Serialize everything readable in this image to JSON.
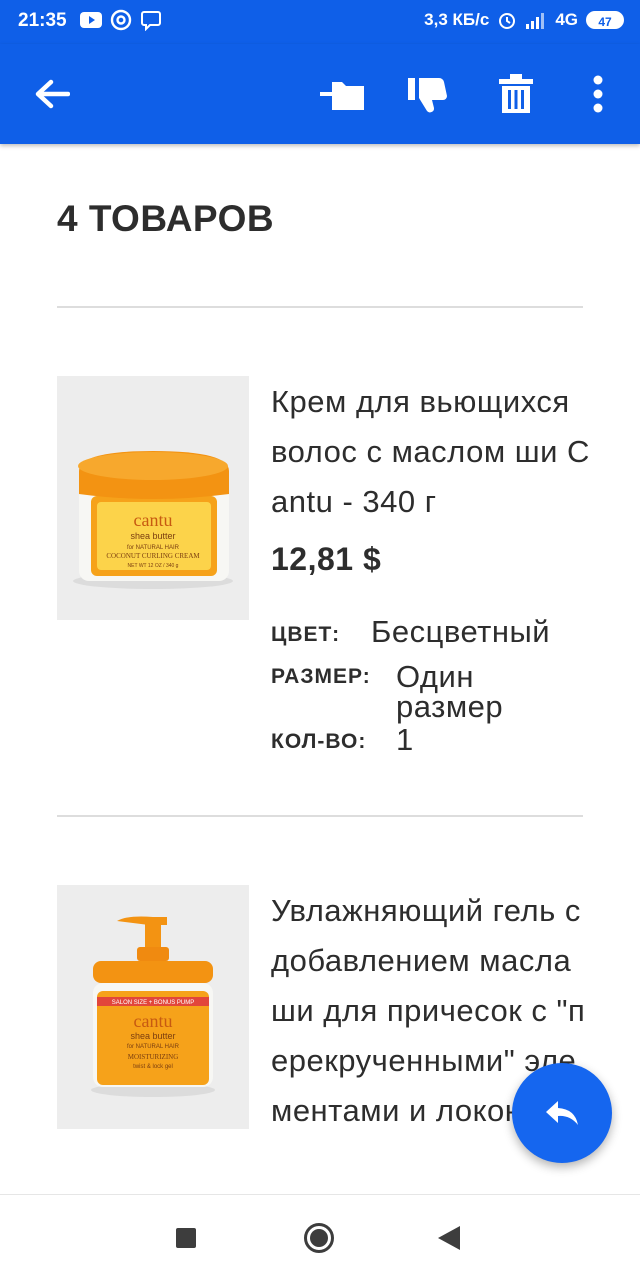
{
  "status_bar": {
    "time": "21:35",
    "speed": "3,3 КБ/с",
    "network": "4G",
    "battery": "47"
  },
  "toolbar": {
    "icons": [
      "back-arrow-icon",
      "move-to-folder-icon",
      "thumbs-down-icon",
      "trash-icon",
      "more-vert-icon"
    ]
  },
  "order": {
    "count_title": "4 ТОВАРОВ",
    "items": [
      {
        "name": "Крем для вьющихся волос с маслом ши Cantu - 340 г",
        "price": "12,81 $",
        "color_label": "ЦВЕТ:",
        "color_value": "Бесцветный",
        "size_label": "РАЗМЕР:",
        "size_value_line1": "Один",
        "size_value_line2": "размер",
        "qty_label": "КОЛ-ВО:",
        "qty_value": "1",
        "image": {
          "brand": "cantu",
          "line1": "shea butter",
          "line2": "for NATURAL HAIR",
          "product": "COCONUT CURLING CREAM",
          "weight": "NET WT 12 OZ / 340 g"
        }
      },
      {
        "name": "Увлажняющий гель с добавлением масла ши для причесок с \"перекрученными\" элементами и локонов",
        "image": {
          "banner": "SALON SIZE + BONUS PUMP",
          "brand": "cantu",
          "line1": "shea butter",
          "line2": "for NATURAL HAIR",
          "product": "MOISTURIZING",
          "sub": "twist & lock gel"
        }
      }
    ]
  },
  "fab": {
    "icon": "reply-icon"
  },
  "nav": {
    "icons": [
      "recents-square-icon",
      "home-circle-icon",
      "back-triangle-icon"
    ]
  },
  "colors": {
    "primary": "#0f5fe8",
    "fab": "#1566ef",
    "text": "#2d2d2d",
    "divider": "#dddddd"
  }
}
